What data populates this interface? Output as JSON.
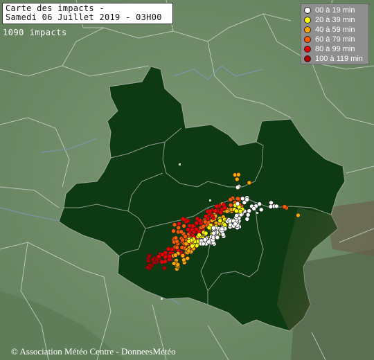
{
  "header": {
    "title_line1": "Carte des impacts -",
    "title_line2": "Samedi 06 Juillet 2019 - 03H00",
    "impact_count": "1090 impacts"
  },
  "legend": {
    "items": [
      {
        "label": "00 à 19 min",
        "color": "#ffffff"
      },
      {
        "label": "20 à 39 min",
        "color": "#ffff00"
      },
      {
        "label": "40 à 59 min",
        "color": "#ffa500"
      },
      {
        "label": "60 à 79 min",
        "color": "#ff5a00"
      },
      {
        "label": "80 à 99 min",
        "color": "#ee0000"
      },
      {
        "label": "100 à 119 min",
        "color": "#aa0000"
      }
    ]
  },
  "footer": {
    "copyright": "© Association Météo Centre - DonneesMétéo"
  },
  "colors": {
    "background_terrain": "#6f8a68",
    "region_fill": "#0f3a14",
    "borders": "#c8ccc8",
    "rivers": "#6a8caa"
  }
}
